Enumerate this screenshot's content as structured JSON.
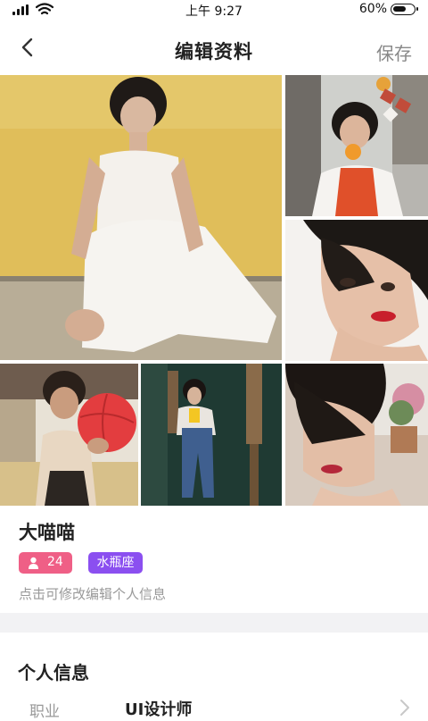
{
  "status_bar": {
    "time": "上午 9:27",
    "battery_percent": "60%"
  },
  "nav": {
    "title": "编辑资料",
    "save_label": "保存",
    "back_icon": "chevron-left-icon"
  },
  "photos": [
    {
      "id": "photo-main",
      "description_colors": [
        "#e6c35c",
        "#f0ede8"
      ]
    },
    {
      "id": "photo-2"
    },
    {
      "id": "photo-3"
    },
    {
      "id": "photo-4"
    },
    {
      "id": "photo-5"
    },
    {
      "id": "photo-6"
    }
  ],
  "profile": {
    "nickname": "大喵喵",
    "age": "24",
    "zodiac": "水瓶座",
    "edit_hint": "点击可修改编辑个人信息",
    "age_badge_color": "#ef5f86",
    "zodiac_badge_color": "#8b4ff0"
  },
  "personal_info": {
    "section_title": "个人信息",
    "rows": [
      {
        "label": "职业",
        "value": "UI设计师"
      }
    ]
  }
}
